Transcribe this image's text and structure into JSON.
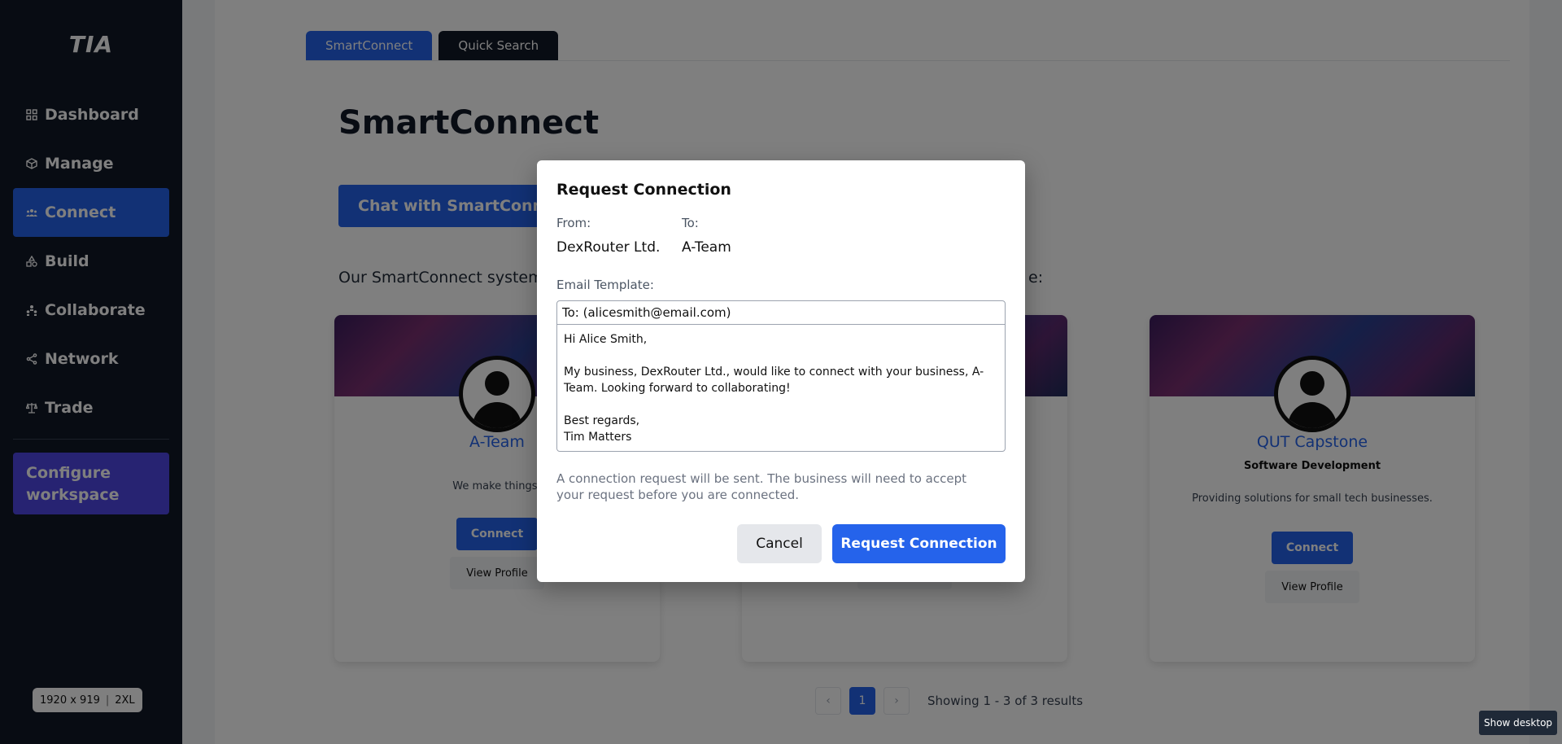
{
  "sidebar": {
    "logo": "TIA",
    "items": [
      {
        "label": "Dashboard",
        "icon": "grid-icon"
      },
      {
        "label": "Manage",
        "icon": "cube-icon"
      },
      {
        "label": "Connect",
        "icon": "users-icon",
        "active": true
      },
      {
        "label": "Build",
        "icon": "shapes-icon"
      },
      {
        "label": "Collaborate",
        "icon": "team-icon"
      },
      {
        "label": "Network",
        "icon": "share-icon"
      },
      {
        "label": "Trade",
        "icon": "scale-icon"
      }
    ],
    "configure_label": "Configure workspace",
    "screen_size": "1920 x 919",
    "screen_breakpoint": "2XL"
  },
  "tabs": [
    {
      "label": "SmartConnect",
      "active": true
    },
    {
      "label": "Quick Search",
      "active": false
    }
  ],
  "page": {
    "title": "SmartConnect",
    "chat_button": "Chat with SmartConnect",
    "intro_text": "Our SmartConnect system",
    "intro_tail": "e:"
  },
  "cards": [
    {
      "name": "A-Team",
      "category": "",
      "description": "We make things!",
      "connect_label": "Connect",
      "view_label": "View Profile"
    },
    {
      "name": "",
      "category": "",
      "description": "",
      "connect_label": "",
      "view_label": ""
    },
    {
      "name": "QUT Capstone",
      "category": "Software Development",
      "description": "Providing solutions for small tech businesses.",
      "connect_label": "Connect",
      "view_label": "View Profile"
    }
  ],
  "pagination": {
    "prev": "‹",
    "current": "1",
    "next": "›",
    "info": "Showing 1 - 3 of 3 results"
  },
  "modal": {
    "title": "Request Connection",
    "from_label": "From:",
    "from_value": "DexRouter Ltd.",
    "to_label": "To:",
    "to_value": "A-Team",
    "template_label": "Email Template:",
    "to_field": "To: (alicesmith@email.com)",
    "body": "Hi Alice Smith,\n\nMy business, DexRouter Ltd., would like to connect with your business, A-Team. Looking forward to collaborating!\n\nBest regards,\nTim Matters",
    "note": "A connection request will be sent. The business will need to accept your request before you are connected.",
    "cancel_label": "Cancel",
    "request_label": "Request Connection"
  },
  "taskbar": {
    "show_desktop": "Show desktop"
  },
  "colors": {
    "primary": "#2563eb",
    "sidebar": "#111827",
    "configure": "#4f46e5"
  }
}
